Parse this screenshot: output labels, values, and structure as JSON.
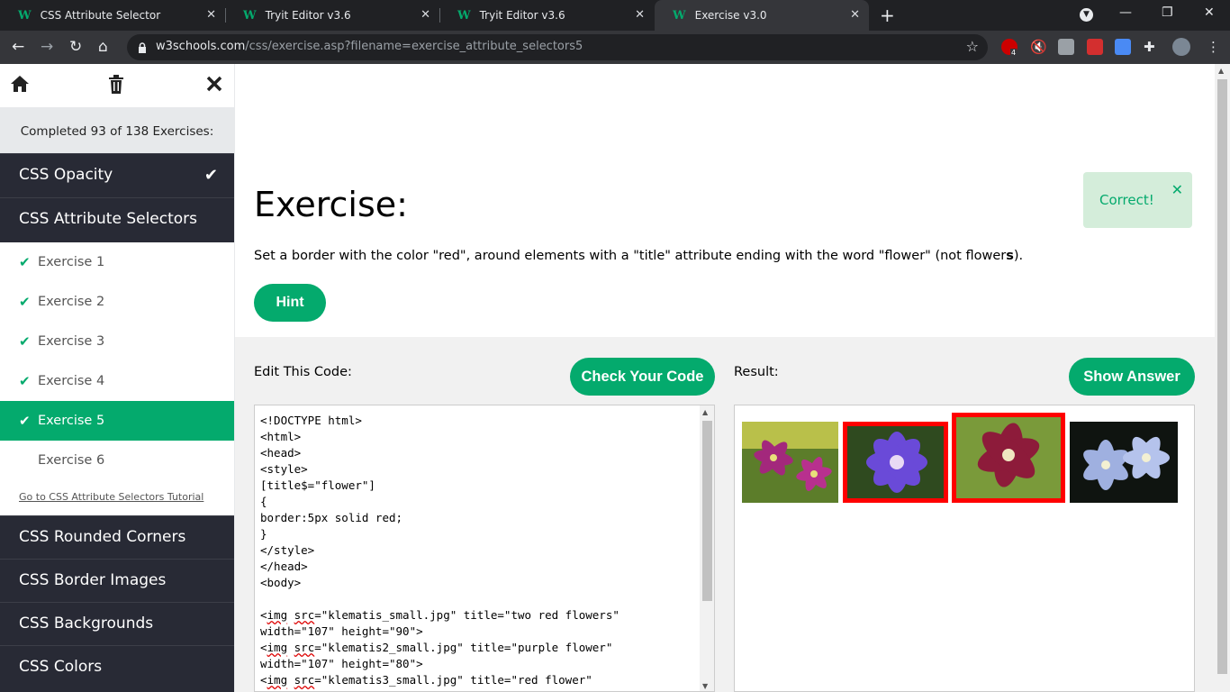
{
  "browser": {
    "tabs": [
      {
        "title": "CSS Attribute Selector"
      },
      {
        "title": "Tryit Editor v3.6"
      },
      {
        "title": "Tryit Editor v3.6"
      },
      {
        "title": "Exercise v3.0"
      }
    ],
    "active_tab": 3,
    "url_host": "w3schools.com",
    "url_path": "/css/exercise.asp?filename=exercise_attribute_selectors5",
    "extension_badge": "4"
  },
  "sidebar": {
    "completed_text": "Completed 93 of 138 Exercises:",
    "categories_top": [
      {
        "label": "CSS Opacity",
        "done": true
      },
      {
        "label": "CSS Attribute Selectors",
        "done": false
      }
    ],
    "exercises": [
      {
        "label": "Exercise 1",
        "done": true
      },
      {
        "label": "Exercise 2",
        "done": true
      },
      {
        "label": "Exercise 3",
        "done": true
      },
      {
        "label": "Exercise 4",
        "done": true
      },
      {
        "label": "Exercise 5",
        "done": true,
        "active": true
      },
      {
        "label": "Exercise 6",
        "done": false
      }
    ],
    "tutorial_link": "Go to CSS Attribute Selectors Tutorial",
    "categories_bottom": [
      {
        "label": "CSS Rounded Corners"
      },
      {
        "label": "CSS Border Images"
      },
      {
        "label": "CSS Backgrounds"
      },
      {
        "label": "CSS Colors"
      }
    ]
  },
  "main": {
    "title": "Exercise:",
    "correct_text": "Correct!",
    "instructions_prefix": "Set a border with the color \"red\", around elements with a \"title\" attribute ending with the word \"flower\" (not flower",
    "instructions_bold": "s",
    "instructions_suffix": ").",
    "hint_label": "Hint",
    "edit_label": "Edit This Code:",
    "check_label": "Check Your Code",
    "result_label": "Result:",
    "answer_label": "Show Answer",
    "code_lines": [
      "<!DOCTYPE html>",
      "<html>",
      "<head>",
      "<style>",
      "[title$=\"flower\"]",
      "{",
      "border:5px solid red;",
      "}",
      "</style>",
      "</head>",
      "<body>",
      "",
      "<img src=\"klematis_small.jpg\" title=\"two red flowers\"",
      "width=\"107\" height=\"90\">",
      "<img src=\"klematis2_small.jpg\" title=\"purple flower\"",
      "width=\"107\" height=\"80\">",
      "<img src=\"klematis3_small.jpg\" title=\"red flower\""
    ]
  },
  "colors": {
    "accent": "#04aa6d",
    "sidebar_bg": "#282a35",
    "correct_bg": "#d4edda",
    "border_red": "#ff0000"
  }
}
